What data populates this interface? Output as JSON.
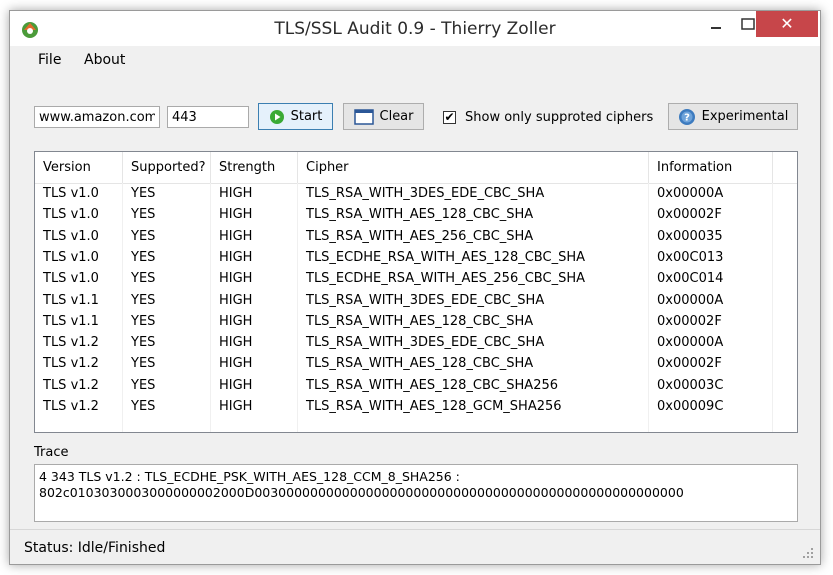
{
  "window": {
    "title": "TLS/SSL Audit 0.9  - Thierry Zoller",
    "close_glyph": "✕"
  },
  "menu": {
    "file": "File",
    "about": "About"
  },
  "toolbar": {
    "host": "www.amazon.com",
    "port": "443",
    "start_label": "Start",
    "clear_label": "Clear",
    "checkbox_label": "Show only supproted ciphers",
    "checkbox_checked": true,
    "check_glyph": "✔",
    "experimental_label": "Experimental"
  },
  "table": {
    "columns": [
      "Version",
      "Supported?",
      "Strength",
      "Cipher",
      "Information"
    ],
    "rows": [
      [
        "TLS v1.0",
        "YES",
        "HIGH",
        "TLS_RSA_WITH_3DES_EDE_CBC_SHA",
        "0x00000A"
      ],
      [
        "TLS v1.0",
        "YES",
        "HIGH",
        "TLS_RSA_WITH_AES_128_CBC_SHA",
        "0x00002F"
      ],
      [
        "TLS v1.0",
        "YES",
        "HIGH",
        "TLS_RSA_WITH_AES_256_CBC_SHA",
        "0x000035"
      ],
      [
        "TLS v1.0",
        "YES",
        "HIGH",
        "TLS_ECDHE_RSA_WITH_AES_128_CBC_SHA",
        "0x00C013"
      ],
      [
        "TLS v1.0",
        "YES",
        "HIGH",
        "TLS_ECDHE_RSA_WITH_AES_256_CBC_SHA",
        "0x00C014"
      ],
      [
        "TLS v1.1",
        "YES",
        "HIGH",
        "TLS_RSA_WITH_3DES_EDE_CBC_SHA",
        "0x00000A"
      ],
      [
        "TLS v1.1",
        "YES",
        "HIGH",
        "TLS_RSA_WITH_AES_128_CBC_SHA",
        "0x00002F"
      ],
      [
        "TLS v1.2",
        "YES",
        "HIGH",
        "TLS_RSA_WITH_3DES_EDE_CBC_SHA",
        "0x00000A"
      ],
      [
        "TLS v1.2",
        "YES",
        "HIGH",
        "TLS_RSA_WITH_AES_128_CBC_SHA",
        "0x00002F"
      ],
      [
        "TLS v1.2",
        "YES",
        "HIGH",
        "TLS_RSA_WITH_AES_128_CBC_SHA256",
        "0x00003C"
      ],
      [
        "TLS v1.2",
        "YES",
        "HIGH",
        "TLS_RSA_WITH_AES_128_GCM_SHA256",
        "0x00009C"
      ]
    ]
  },
  "trace": {
    "label": "Trace",
    "text": "4 343 TLS v1.2 : TLS_ECDHE_PSK_WITH_AES_128_CCM_8_SHA256 :\n802c0103030003000000002000D003000000000000000000000000000000000000000000000000000"
  },
  "status": {
    "text": "Status: Idle/Finished"
  },
  "colors": {
    "close_red": "#c7464a",
    "start_icon_green": "#3aaa35",
    "experimental_icon_blue": "#3d7bbf"
  },
  "icons": {
    "app": "shield-arrow-icon",
    "start": "play-icon",
    "clear": "window-icon",
    "experimental": "help-icon",
    "grip": "resize-grip-icon"
  }
}
